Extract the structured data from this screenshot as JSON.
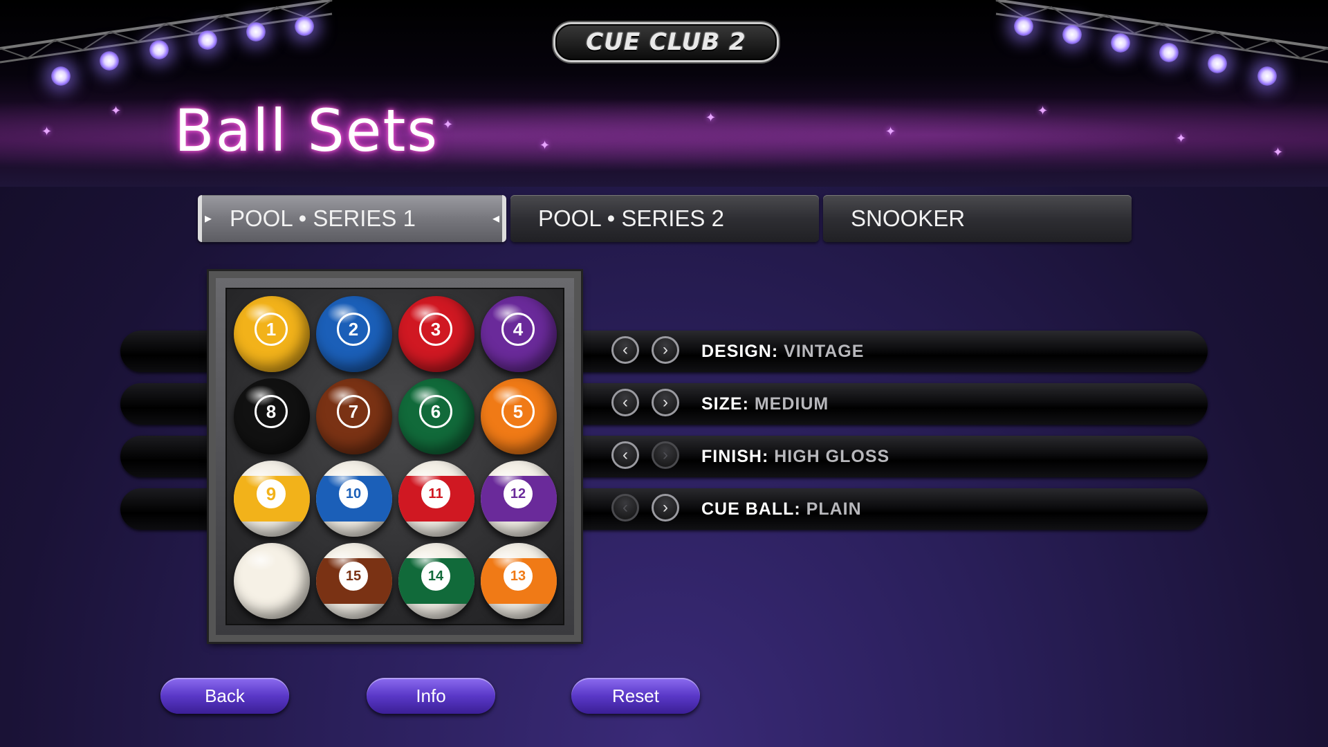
{
  "header": {
    "logo_text": "CUE CLUB 2",
    "page_title": "Ball Sets"
  },
  "tabs": [
    {
      "label": "POOL • SERIES 1",
      "active": true
    },
    {
      "label": "POOL • SERIES 2",
      "active": false
    },
    {
      "label": "SNOOKER",
      "active": false
    }
  ],
  "options": [
    {
      "label": "DESIGN:",
      "value": "VINTAGE",
      "prev_enabled": true,
      "next_enabled": true
    },
    {
      "label": "SIZE:",
      "value": "MEDIUM",
      "prev_enabled": true,
      "next_enabled": true
    },
    {
      "label": "FINISH:",
      "value": "HIGH GLOSS",
      "prev_enabled": true,
      "next_enabled": false
    },
    {
      "label": "CUE BALL:",
      "value": "PLAIN",
      "prev_enabled": false,
      "next_enabled": true
    }
  ],
  "balls": [
    {
      "number": "1",
      "color": "#f2b21a",
      "type": "solid"
    },
    {
      "number": "2",
      "color": "#1b5fb8",
      "type": "solid"
    },
    {
      "number": "3",
      "color": "#d01822",
      "type": "solid"
    },
    {
      "number": "4",
      "color": "#6a2a9a",
      "type": "solid"
    },
    {
      "number": "8",
      "color": "#111111",
      "type": "solid"
    },
    {
      "number": "7",
      "color": "#7a3214",
      "type": "solid"
    },
    {
      "number": "6",
      "color": "#116a3a",
      "type": "solid"
    },
    {
      "number": "5",
      "color": "#f07a16",
      "type": "solid"
    },
    {
      "number": "9",
      "color": "#f2b21a",
      "type": "stripe"
    },
    {
      "number": "10",
      "color": "#1b5fb8",
      "type": "stripe"
    },
    {
      "number": "11",
      "color": "#d01822",
      "type": "stripe"
    },
    {
      "number": "12",
      "color": "#6a2a9a",
      "type": "stripe"
    },
    {
      "number": "",
      "color": "#f6f1e6",
      "type": "cue"
    },
    {
      "number": "15",
      "color": "#7a3214",
      "type": "stripe"
    },
    {
      "number": "14",
      "color": "#116a3a",
      "type": "stripe"
    },
    {
      "number": "13",
      "color": "#f07a16",
      "type": "stripe"
    }
  ],
  "buttons": {
    "back": "Back",
    "info": "Info",
    "reset": "Reset"
  },
  "icons": {
    "prev": "chevron-left-icon",
    "next": "chevron-right-icon"
  }
}
